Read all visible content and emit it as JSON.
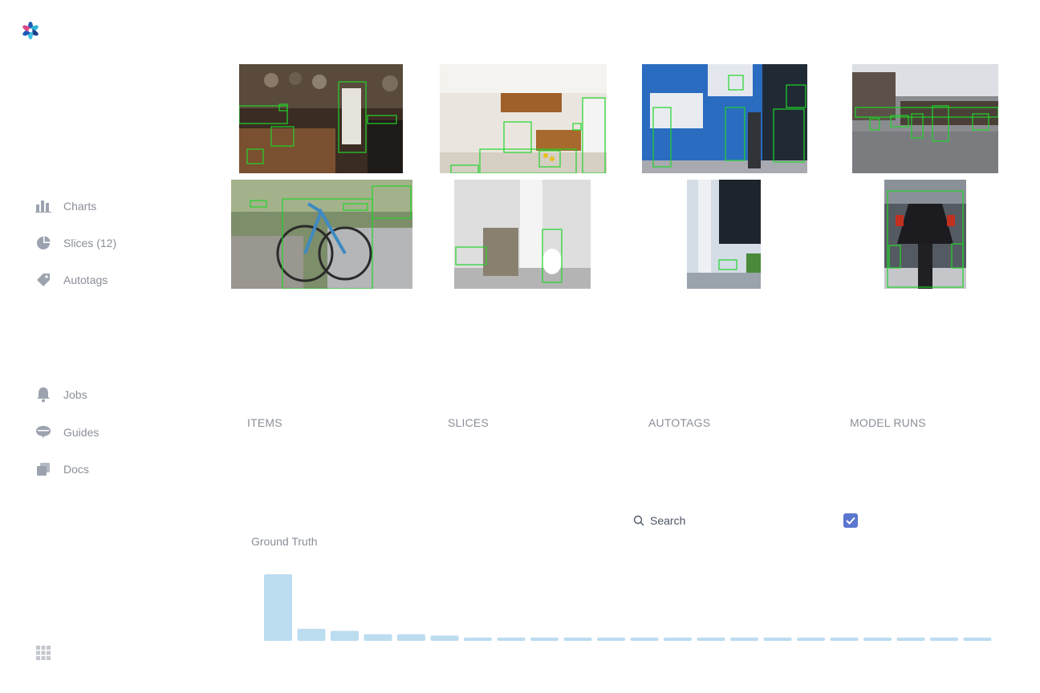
{
  "sidebar": {
    "items": [
      {
        "label": "Charts",
        "icon": "bar-chart-icon"
      },
      {
        "label": "Slices (12)",
        "icon": "pie-slice-icon"
      },
      {
        "label": "Autotags",
        "icon": "tag-icon"
      },
      {
        "label": "Jobs",
        "icon": "bell-icon"
      },
      {
        "label": "Guides",
        "icon": "speech-bubble-icon"
      },
      {
        "label": "Docs",
        "icon": "documents-icon"
      }
    ]
  },
  "gallery": {
    "images": [
      {
        "name": "kitchen-cookware-image"
      },
      {
        "name": "bright-kitchen-image"
      },
      {
        "name": "street-pedestrians-image"
      },
      {
        "name": "street-road-image"
      },
      {
        "name": "bicycle-image"
      },
      {
        "name": "shower-bathroom-image"
      },
      {
        "name": "small-bathroom-image"
      },
      {
        "name": "motorcycle-image"
      }
    ]
  },
  "sections": {
    "items": "ITEMS",
    "slices": "SLICES",
    "autotags": "AUTOTAGS",
    "model_runs": "MODEL RUNS"
  },
  "search": {
    "label": "Search"
  },
  "checkbox": {
    "checked": true
  },
  "colors": {
    "accent": "#5b76cf",
    "bar": "#bcdcf0",
    "box": "#22d42a"
  },
  "chart_data": {
    "type": "bar",
    "title": "Ground Truth",
    "values": [
      100,
      18,
      15,
      10,
      10,
      8,
      5,
      5,
      5,
      5,
      5,
      5,
      5,
      5,
      5,
      5,
      5,
      5,
      5,
      5,
      5,
      5
    ],
    "categories": [],
    "xlabel": "",
    "ylabel": "",
    "grid": false
  }
}
